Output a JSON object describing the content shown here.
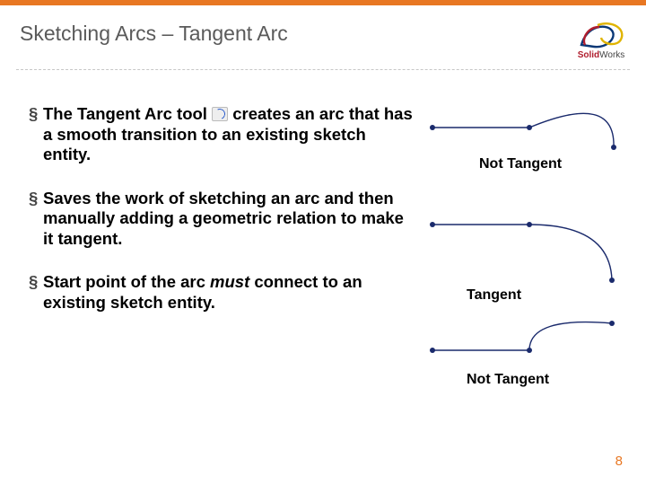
{
  "header": {
    "title": "Sketching Arcs – Tangent Arc"
  },
  "logo": {
    "solid": "Solid",
    "works": "Works"
  },
  "bullets": {
    "b1_pre": "The Tangent Arc tool ",
    "b1_post": " creates an arc that has a smooth transition to an existing sketch entity.",
    "b2": "Saves the work of sketching an arc and then manually adding a geometric relation to make it tangent.",
    "b3_pre": "Start point of the arc ",
    "b3_em": "must",
    "b3_post": " connect to an existing sketch entity."
  },
  "figures": {
    "label_not_tangent_1": "Not Tangent",
    "label_tangent": "Tangent",
    "label_not_tangent_2": "Not Tangent"
  },
  "page_number": "8"
}
